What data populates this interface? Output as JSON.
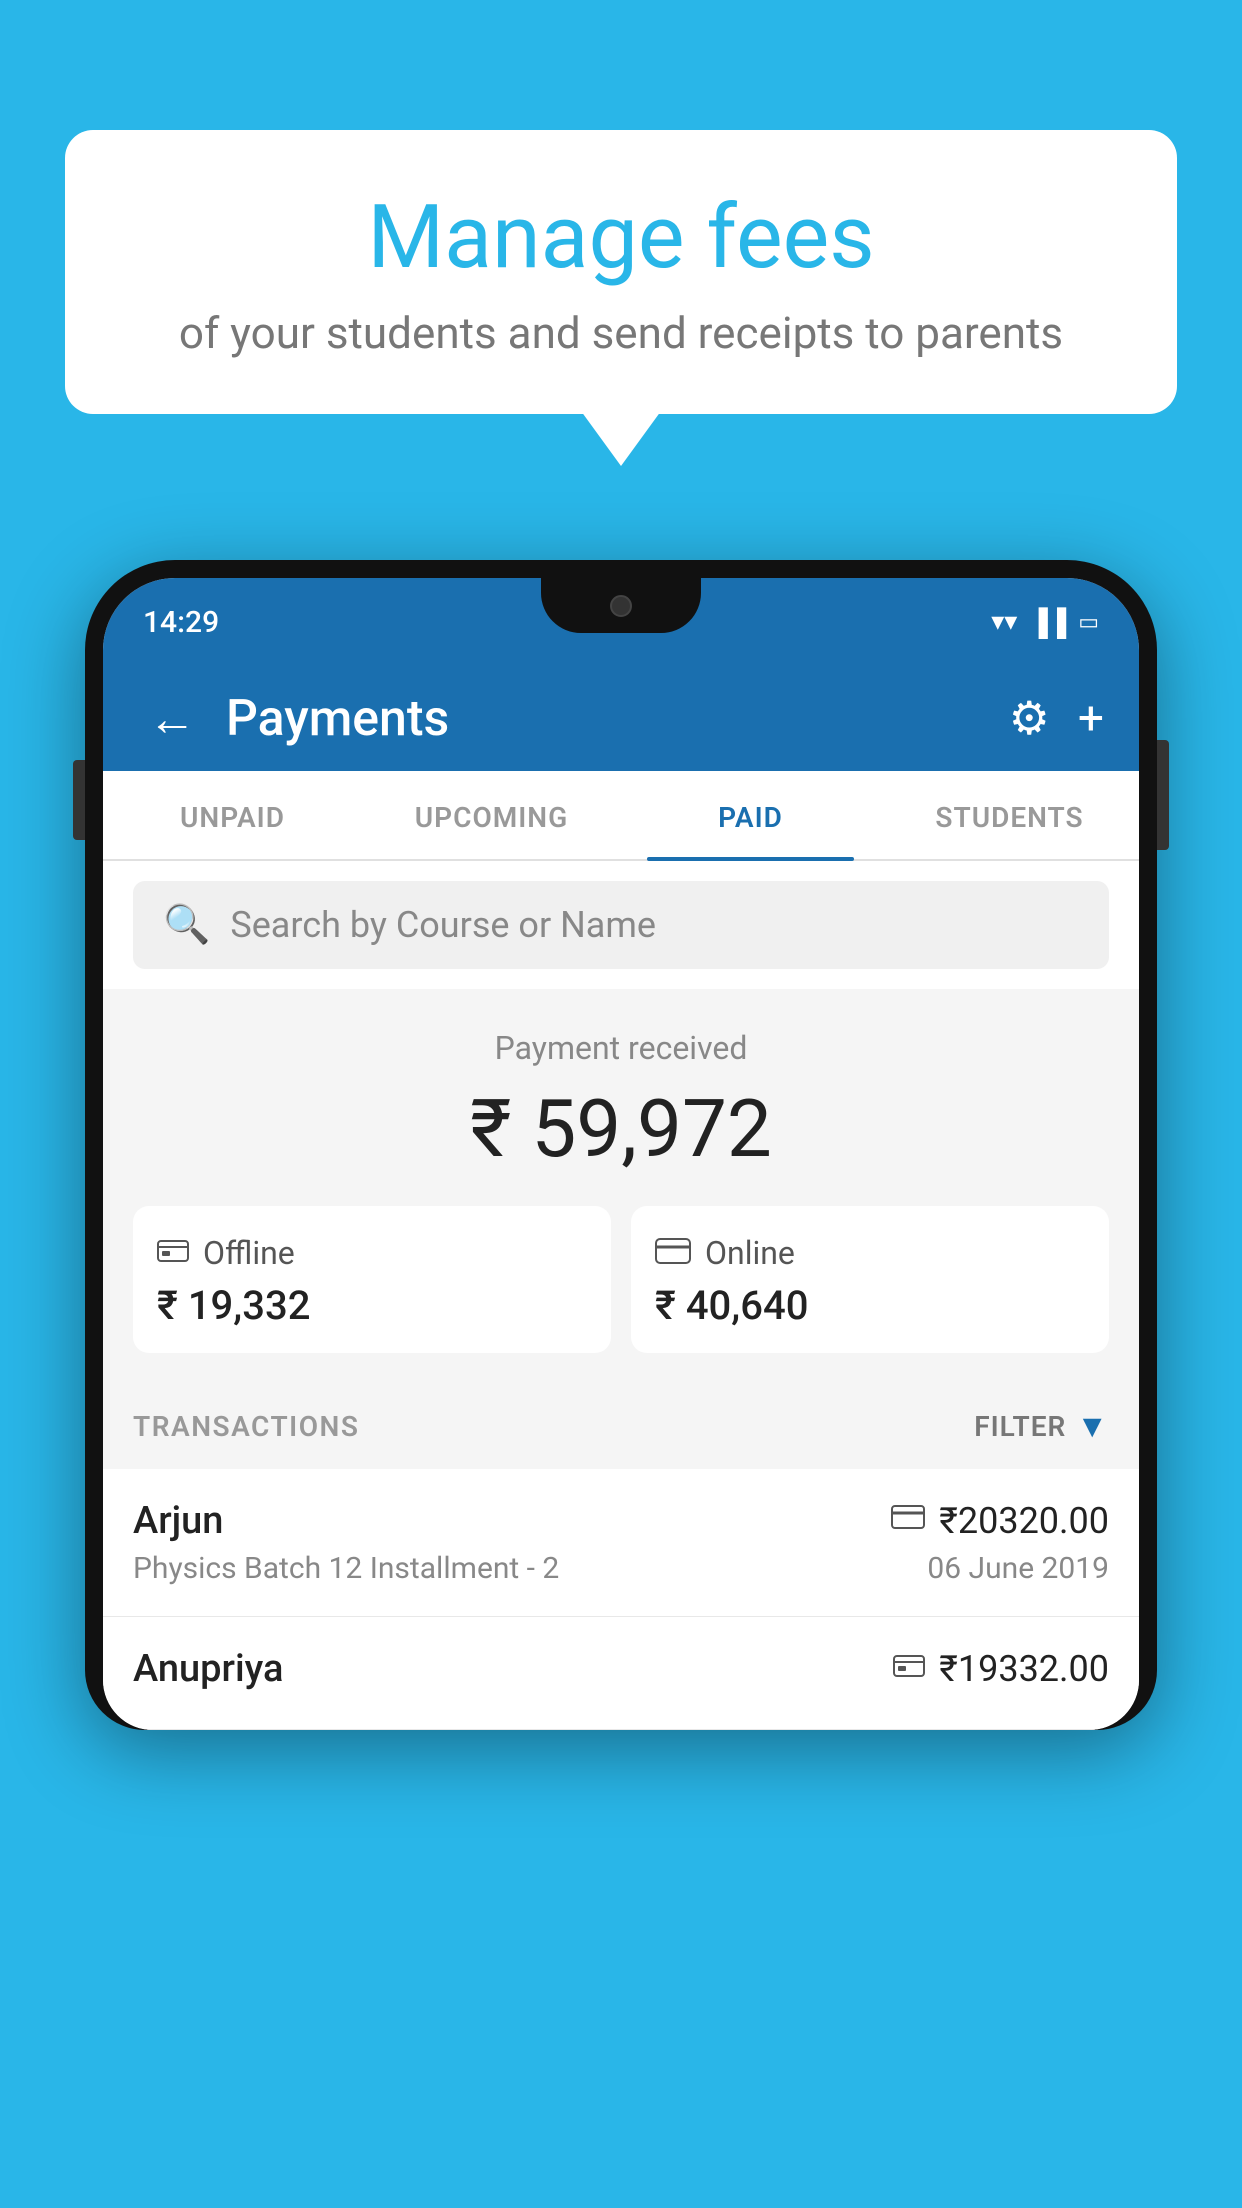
{
  "background_color": "#29B6E8",
  "bubble": {
    "title": "Manage fees",
    "subtitle": "of your students and send receipts to parents"
  },
  "phone": {
    "status_bar": {
      "time": "14:29",
      "wifi": "▲",
      "signal": "▲",
      "battery": "▪"
    },
    "app_bar": {
      "title": "Payments",
      "back_label": "←",
      "gear_label": "⚙",
      "plus_label": "+"
    },
    "tabs": [
      {
        "label": "UNPAID",
        "active": false
      },
      {
        "label": "UPCOMING",
        "active": false
      },
      {
        "label": "PAID",
        "active": true
      },
      {
        "label": "STUDENTS",
        "active": false
      }
    ],
    "search": {
      "placeholder": "Search by Course or Name"
    },
    "payment_summary": {
      "label": "Payment received",
      "amount": "₹ 59,972",
      "offline": {
        "label": "Offline",
        "amount": "₹ 19,332"
      },
      "online": {
        "label": "Online",
        "amount": "₹ 40,640"
      }
    },
    "transactions": {
      "header_label": "TRANSACTIONS",
      "filter_label": "FILTER",
      "rows": [
        {
          "name": "Arjun",
          "course": "Physics Batch 12 Installment - 2",
          "amount": "₹20320.00",
          "date": "06 June 2019",
          "payment_type": "card"
        },
        {
          "name": "Anupriya",
          "course": "",
          "amount": "₹19332.00",
          "date": "",
          "payment_type": "offline"
        }
      ]
    }
  }
}
